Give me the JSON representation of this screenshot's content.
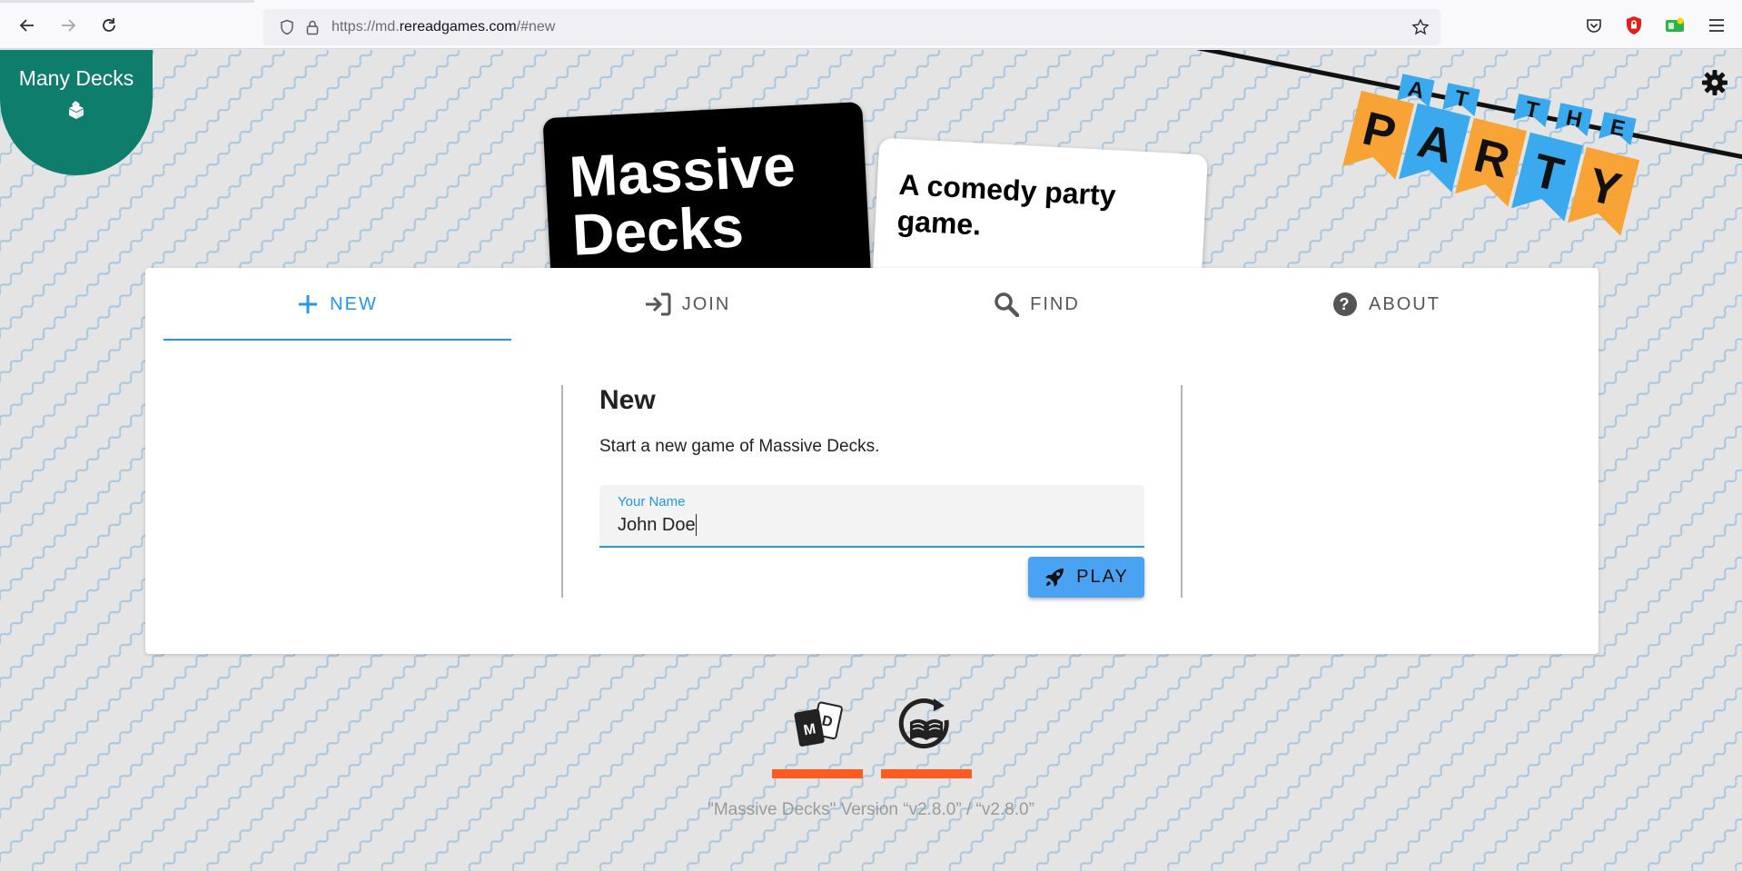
{
  "browser": {
    "url_prefix": "https://md.",
    "url_domain": "rereadgames.com",
    "url_suffix": "/#new"
  },
  "many_decks": {
    "label": "Many Decks"
  },
  "logo": {
    "black_card": "Massive Decks",
    "white_card": "A comedy party game."
  },
  "banner": {
    "line1": "AT THE",
    "line2": "PARTY"
  },
  "tabs": [
    {
      "label": "NEW",
      "active": true
    },
    {
      "label": "JOIN",
      "active": false
    },
    {
      "label": "FIND",
      "active": false
    },
    {
      "label": "ABOUT",
      "active": false
    }
  ],
  "new_game": {
    "title": "New",
    "description": "Start a new game of Massive Decks.",
    "name_label": "Your Name",
    "name_value": "John Doe",
    "play_label": "PLAY"
  },
  "footer": {
    "version": "\"Massive Decks\" Version “v2.8.0” / “v2.8.0”"
  },
  "colors": {
    "accent": "#2196f3",
    "many_decks": "#0e7d6b",
    "footer_bar": "#ff5a1f",
    "banner_orange": "#f7a335",
    "banner_blue": "#3ba9ee"
  }
}
